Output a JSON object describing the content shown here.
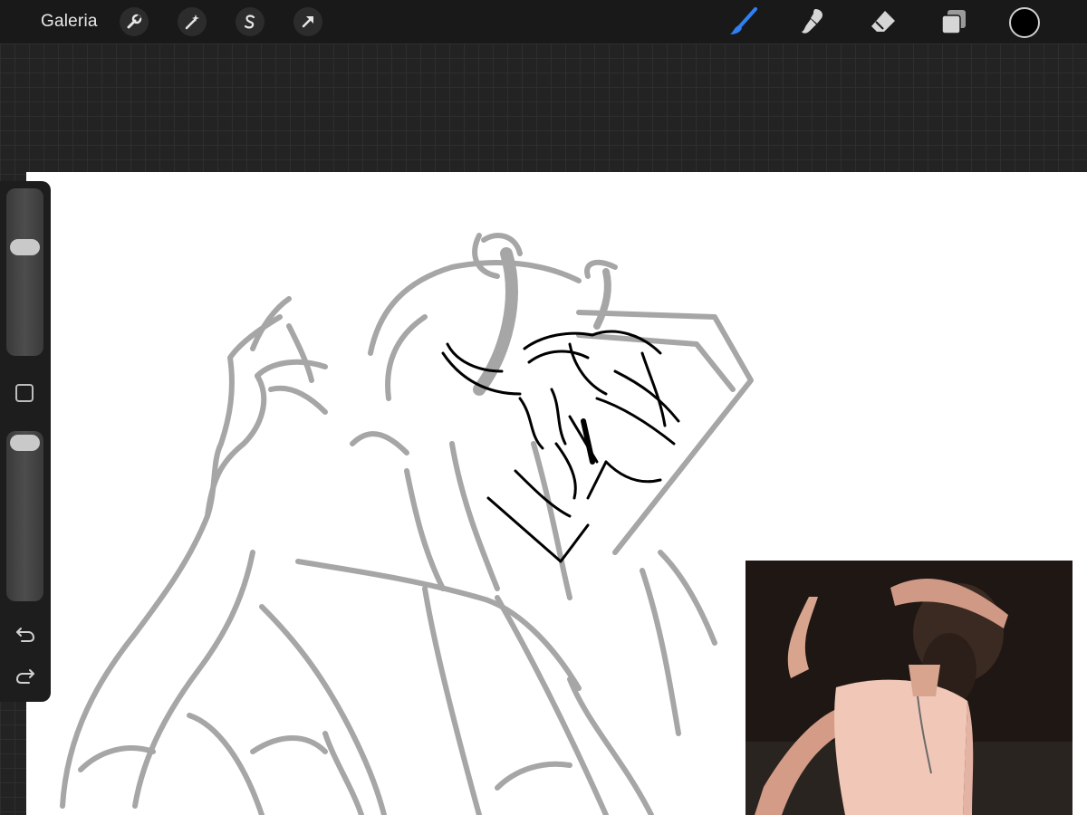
{
  "app": {
    "gallery_label": "Galeria"
  },
  "toolbar": {
    "left_tools": [
      "wrench-icon",
      "magic-wand-icon",
      "selection-s-icon",
      "transform-arrow-icon"
    ],
    "right_tools": [
      "brush-icon",
      "smudge-icon",
      "eraser-icon",
      "layers-icon"
    ],
    "active_tool": "brush",
    "active_color": "#000000",
    "accent": "#2f7ff5"
  },
  "sidebar": {
    "brush_size": 0.85,
    "opacity": 1.0,
    "undo_icon": "undo-arrow-icon",
    "redo_icon": "redo-arrow-icon"
  },
  "canvas": {
    "background": "#ffffff",
    "sketch_color": "#a6a6a6",
    "lineart_color": "#000000"
  }
}
